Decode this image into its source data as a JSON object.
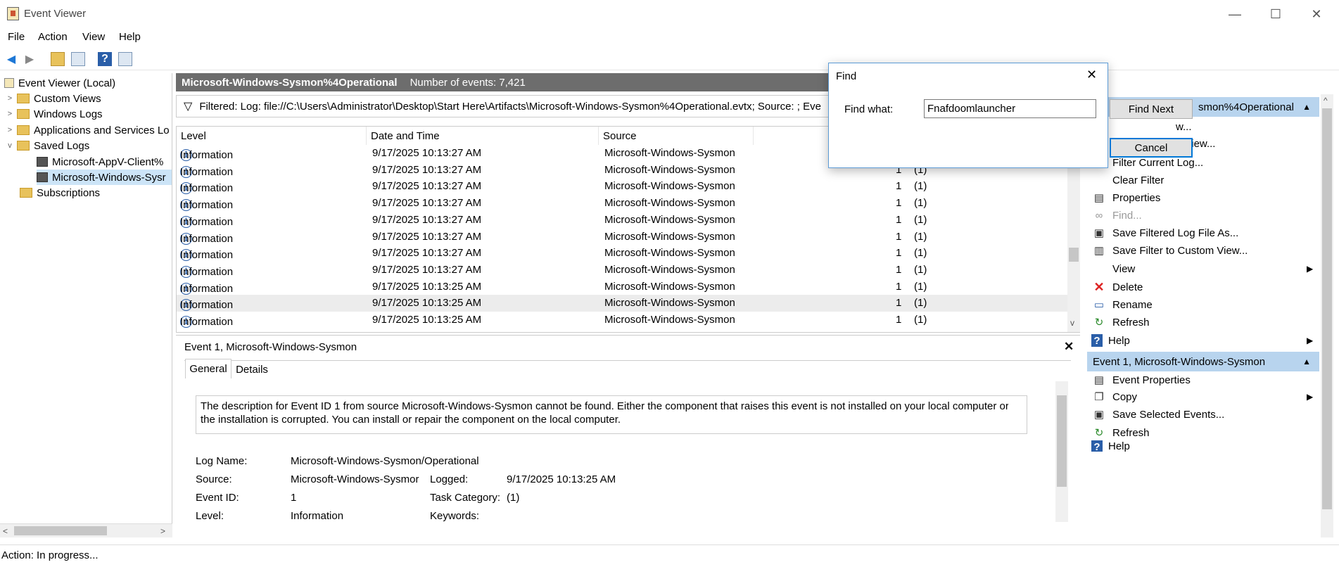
{
  "window": {
    "title": "Event Viewer",
    "minimize": "—",
    "maximize": "☐",
    "close": "✕"
  },
  "menu": [
    "File",
    "Action",
    "View",
    "Help"
  ],
  "tree": {
    "root": "Event Viewer (Local)",
    "items": [
      "Custom Views",
      "Windows Logs",
      "Applications and Services Lo",
      "Saved Logs",
      "Microsoft-AppV-Client%",
      "Microsoft-Windows-Sysr",
      "Subscriptions"
    ]
  },
  "center": {
    "log_name": "Microsoft-Windows-Sysmon%4Operational",
    "event_count": "Number of events: 7,421",
    "filter_text": "Filtered: Log: file://C:\\Users\\Administrator\\Desktop\\Start Here\\Artifacts\\Microsoft-Windows-Sysmon%4Operational.evtx; Source: ; Eve",
    "columns": [
      "Level",
      "Date and Time",
      "Source"
    ],
    "rows": [
      {
        "level": "Information",
        "date": "9/17/2025 10:13:27 AM",
        "source": "Microsoft-Windows-Sysmon",
        "id": "1",
        "task": "(1)"
      },
      {
        "level": "Information",
        "date": "9/17/2025 10:13:27 AM",
        "source": "Microsoft-Windows-Sysmon",
        "id": "1",
        "task": "(1)"
      },
      {
        "level": "Information",
        "date": "9/17/2025 10:13:27 AM",
        "source": "Microsoft-Windows-Sysmon",
        "id": "1",
        "task": "(1)"
      },
      {
        "level": "Information",
        "date": "9/17/2025 10:13:27 AM",
        "source": "Microsoft-Windows-Sysmon",
        "id": "1",
        "task": "(1)"
      },
      {
        "level": "Information",
        "date": "9/17/2025 10:13:27 AM",
        "source": "Microsoft-Windows-Sysmon",
        "id": "1",
        "task": "(1)"
      },
      {
        "level": "Information",
        "date": "9/17/2025 10:13:27 AM",
        "source": "Microsoft-Windows-Sysmon",
        "id": "1",
        "task": "(1)"
      },
      {
        "level": "Information",
        "date": "9/17/2025 10:13:27 AM",
        "source": "Microsoft-Windows-Sysmon",
        "id": "1",
        "task": "(1)"
      },
      {
        "level": "Information",
        "date": "9/17/2025 10:13:27 AM",
        "source": "Microsoft-Windows-Sysmon",
        "id": "1",
        "task": "(1)"
      },
      {
        "level": "Information",
        "date": "9/17/2025 10:13:25 AM",
        "source": "Microsoft-Windows-Sysmon",
        "id": "1",
        "task": "(1)"
      },
      {
        "level": "Information",
        "date": "9/17/2025 10:13:25 AM",
        "source": "Microsoft-Windows-Sysmon",
        "id": "1",
        "task": "(1)"
      },
      {
        "level": "Information",
        "date": "9/17/2025 10:13:25 AM",
        "source": "Microsoft-Windows-Sysmon",
        "id": "1",
        "task": "(1)"
      }
    ]
  },
  "detail": {
    "title": "Event 1, Microsoft-Windows-Sysmon",
    "tabs": [
      "General",
      "Details"
    ],
    "description_line1": "The description for Event ID 1 from source Microsoft-Windows-Sysmon cannot be found. Either the component that raises this event is not installed on your local computer or",
    "description_line2": "the installation is corrupted. You can install or repair the component on the local computer.",
    "fields": {
      "log_name_label": "Log Name:",
      "log_name": "Microsoft-Windows-Sysmon/Operational",
      "source_label": "Source:",
      "source": "Microsoft-Windows-Sysmor",
      "logged_label": "Logged:",
      "logged": "9/17/2025 10:13:25 AM",
      "event_id_label": "Event ID:",
      "event_id": "1",
      "task_label": "Task Category:",
      "task": "(1)",
      "level_label": "Level:",
      "level": "Information",
      "keywords_label": "Keywords:"
    }
  },
  "actions": {
    "group1": "smon%4Operational",
    "items1": [
      "w...",
      "Import Custom View...",
      "Filter Current Log...",
      "Clear Filter",
      "Properties",
      "Find...",
      "Save Filtered Log File As...",
      "Save Filter to Custom View...",
      "View",
      "Delete",
      "Rename",
      "Refresh",
      "Help"
    ],
    "group2": "Event 1, Microsoft-Windows-Sysmon",
    "items2": [
      "Event Properties",
      "Copy",
      "Save Selected Events...",
      "Refresh",
      "Help"
    ]
  },
  "status": {
    "text": "Action:  In progress..."
  },
  "find": {
    "title": "Find",
    "label": "Find what:",
    "value": "Fnafdoomlauncher",
    "find_next": "Find Next",
    "cancel": "Cancel"
  },
  "colors": {
    "accent": "#0078d7",
    "panel_header": "#6d6d6d",
    "action_group": "#b8d4ee"
  }
}
